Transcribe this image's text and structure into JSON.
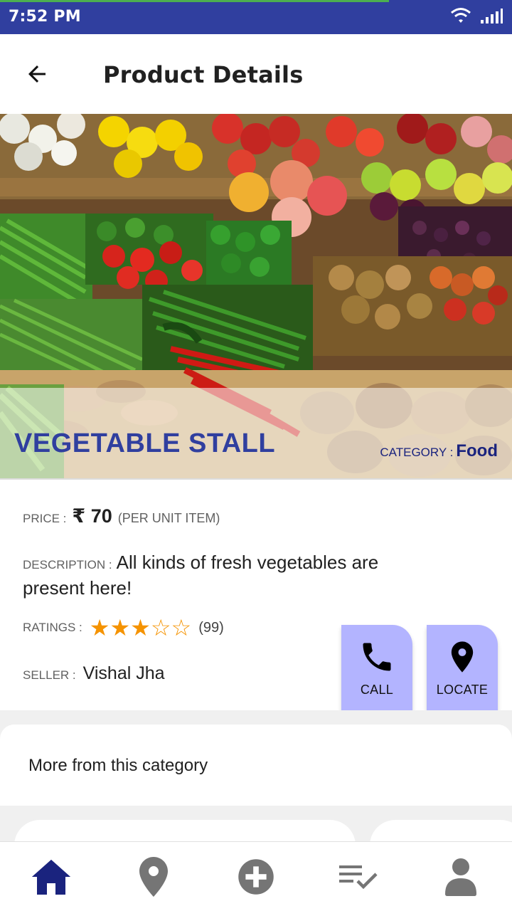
{
  "status_bar": {
    "time": "7:52 PM",
    "icons": [
      "wifi-icon",
      "cell-signal-icon"
    ]
  },
  "app_bar": {
    "title": "Product Details",
    "back_icon": "back-arrow-icon"
  },
  "product": {
    "name": "VEGETABLE STALL",
    "category_label": "CATEGORY :",
    "category": "Food",
    "price_label": "PRICE :",
    "price": "₹ 70",
    "price_unit": "(PER UNIT ITEM)",
    "description_label": "DESCRIPTION :",
    "description": "All kinds of fresh vegetables are present here!",
    "ratings_label": "RATINGS :",
    "rating": 3,
    "rating_max": 5,
    "rating_stars": "★★★☆☆",
    "rating_count": "(99)",
    "seller_label": "SELLER :",
    "seller": "Vishal Jha"
  },
  "actions": {
    "call_label": "CALL",
    "call_icon": "phone-icon",
    "locate_label": "LOCATE",
    "locate_icon": "map-pin-icon"
  },
  "more": {
    "title": "More from this category"
  },
  "bottom_nav": {
    "items": [
      {
        "icon": "home-icon",
        "active": true
      },
      {
        "icon": "location-icon",
        "active": false
      },
      {
        "icon": "add-circle-icon",
        "active": false
      },
      {
        "icon": "checklist-icon",
        "active": false
      },
      {
        "icon": "profile-icon",
        "active": false
      }
    ]
  },
  "colors": {
    "primary": "#303f9f",
    "accent_button": "#b3b4ff",
    "star": "#f59300",
    "active_nav": "#1a237e",
    "inactive_nav": "#757575"
  }
}
